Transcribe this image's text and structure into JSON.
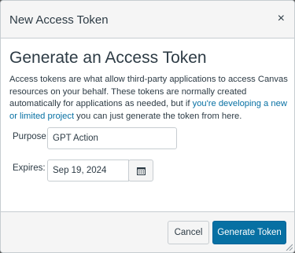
{
  "dialog": {
    "title": "New Access Token",
    "close_glyph": "×"
  },
  "content": {
    "heading": "Generate an Access Token",
    "description_before_link": "Access tokens are what allow third-party applications to access Canvas resources on your behalf. These tokens are normally created automatically for applications as needed, but if ",
    "description_link": "you're developing a new or limited project",
    "description_after_link": " you can just generate the token from here."
  },
  "form": {
    "purpose_label": "Purpose:",
    "purpose_value": "GPT Action",
    "expires_label": "Expires:",
    "expires_value": "Sep 19, 2024",
    "calendar_icon": "calendar-icon"
  },
  "footer": {
    "cancel_label": "Cancel",
    "generate_label": "Generate Token"
  },
  "colors": {
    "accent": "#0770a3",
    "text": "#2d3b45",
    "border": "#c7cdd1",
    "surface": "#f5f5f5"
  }
}
